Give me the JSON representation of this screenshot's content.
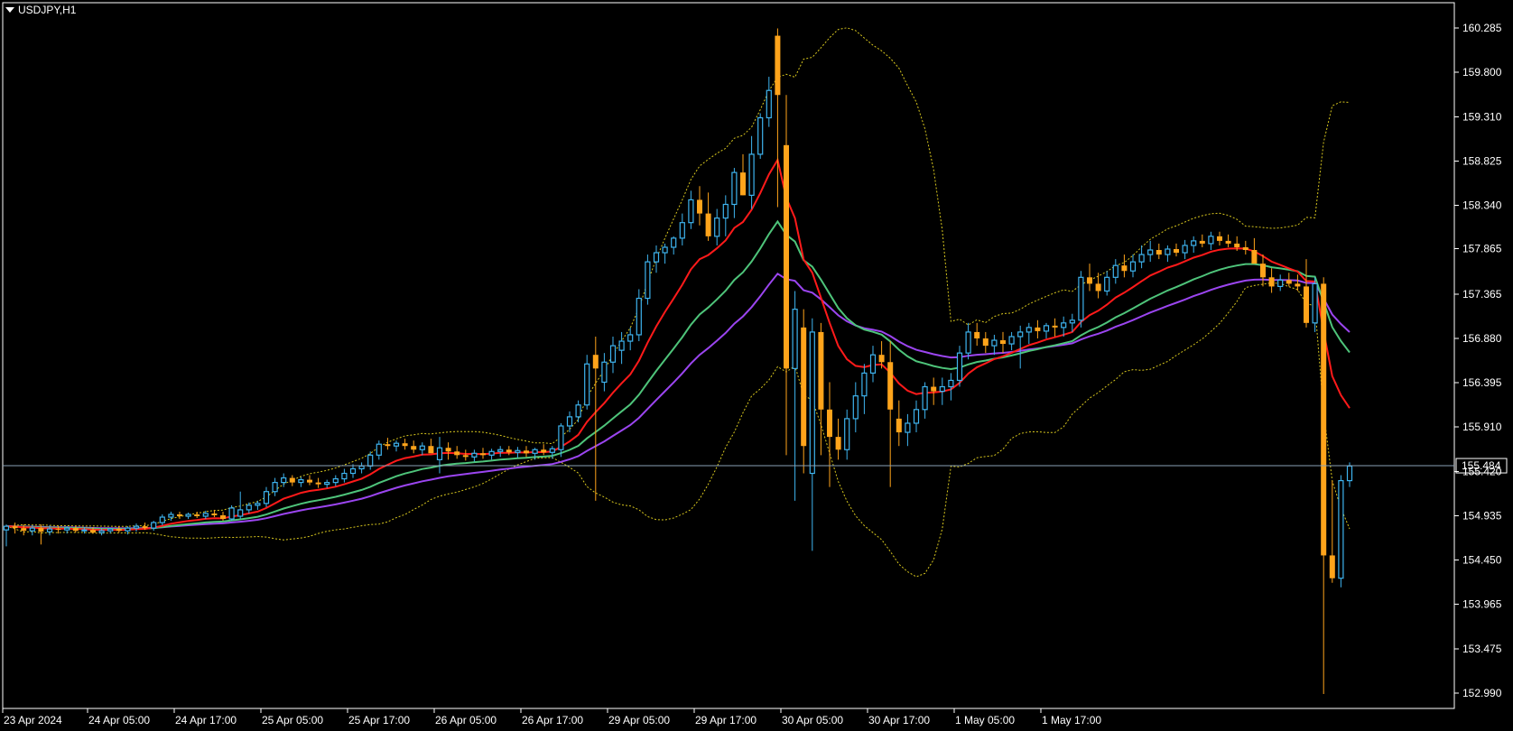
{
  "window": {
    "symbol_label": "USDJPY,H1"
  },
  "colors": {
    "background": "#000000",
    "frame": "#ffffff",
    "bull": "#3eb4ef",
    "bear": "#ffa41b",
    "ma_fast": "#ff1a1a",
    "ma_mid": "#4ec47a",
    "ma_slow": "#9b45f0",
    "envelope": "#d8c71e",
    "price_line": "#8aa0b4"
  },
  "chart_data": {
    "type": "candlestick",
    "symbol": "USDJPY",
    "timeframe": "H1",
    "price_axis": {
      "ticks": [
        "160.285",
        "159.800",
        "159.310",
        "158.825",
        "158.340",
        "157.865",
        "157.365",
        "156.880",
        "156.395",
        "155.910",
        "155.420",
        "154.935",
        "154.450",
        "153.965",
        "153.475",
        "152.990"
      ],
      "min": 152.99,
      "max": 160.285
    },
    "time_axis": {
      "labels": [
        "23 Apr 2024",
        "24 Apr 05:00",
        "24 Apr 17:00",
        "25 Apr 05:00",
        "25 Apr 17:00",
        "26 Apr 05:00",
        "26 Apr 17:00",
        "29 Apr 05:00",
        "29 Apr 17:00",
        "30 Apr 05:00",
        "30 Apr 17:00",
        "1 May 05:00",
        "1 May 17:00"
      ]
    },
    "current_price": "155.484",
    "candles": [
      [
        154.78,
        154.84,
        154.6,
        154.82
      ],
      [
        154.82,
        154.86,
        154.74,
        154.8
      ],
      [
        154.8,
        154.84,
        154.72,
        154.77
      ],
      [
        154.77,
        154.83,
        154.72,
        154.8
      ],
      [
        154.8,
        154.84,
        154.62,
        154.76
      ],
      [
        154.76,
        154.83,
        154.72,
        154.79
      ],
      [
        154.79,
        154.82,
        154.74,
        154.78
      ],
      [
        154.78,
        154.82,
        154.74,
        154.8
      ],
      [
        154.8,
        154.82,
        154.75,
        154.77
      ],
      [
        154.77,
        154.81,
        154.74,
        154.78
      ],
      [
        154.78,
        154.81,
        154.74,
        154.75
      ],
      [
        154.75,
        154.8,
        154.72,
        154.77
      ],
      [
        154.77,
        154.8,
        154.74,
        154.79
      ],
      [
        154.79,
        154.82,
        154.75,
        154.77
      ],
      [
        154.77,
        154.82,
        154.73,
        154.8
      ],
      [
        154.8,
        154.85,
        154.76,
        154.82
      ],
      [
        154.82,
        154.86,
        154.78,
        154.8
      ],
      [
        154.8,
        154.88,
        154.77,
        154.86
      ],
      [
        154.86,
        154.95,
        154.83,
        154.92
      ],
      [
        154.92,
        154.98,
        154.88,
        154.95
      ],
      [
        154.95,
        154.98,
        154.9,
        154.93
      ],
      [
        154.93,
        154.97,
        154.9,
        154.95
      ],
      [
        154.95,
        154.98,
        154.91,
        154.93
      ],
      [
        154.93,
        154.99,
        154.9,
        154.96
      ],
      [
        154.96,
        155.0,
        154.92,
        154.94
      ],
      [
        154.94,
        154.98,
        154.88,
        154.9
      ],
      [
        154.9,
        155.05,
        154.88,
        155.02
      ],
      [
        154.93,
        155.2,
        154.9,
        155.0
      ],
      [
        155.0,
        155.08,
        154.96,
        155.05
      ],
      [
        155.05,
        155.1,
        155.0,
        155.07
      ],
      [
        155.07,
        155.25,
        155.03,
        155.2
      ],
      [
        155.2,
        155.35,
        155.15,
        155.3
      ],
      [
        155.3,
        155.4,
        155.25,
        155.35
      ],
      [
        155.35,
        155.38,
        155.26,
        155.3
      ],
      [
        155.3,
        155.36,
        155.25,
        155.33
      ],
      [
        155.33,
        155.38,
        155.27,
        155.3
      ],
      [
        155.3,
        155.35,
        155.24,
        155.28
      ],
      [
        155.28,
        155.33,
        155.24,
        155.3
      ],
      [
        155.3,
        155.38,
        155.26,
        155.34
      ],
      [
        155.34,
        155.45,
        155.3,
        155.4
      ],
      [
        155.4,
        155.5,
        155.35,
        155.45
      ],
      [
        155.45,
        155.52,
        155.4,
        155.48
      ],
      [
        155.48,
        155.64,
        155.44,
        155.6
      ],
      [
        155.6,
        155.76,
        155.55,
        155.72
      ],
      [
        155.72,
        155.79,
        155.66,
        155.7
      ],
      [
        155.7,
        155.76,
        155.64,
        155.73
      ],
      [
        155.73,
        155.78,
        155.66,
        155.7
      ],
      [
        155.7,
        155.76,
        155.62,
        155.66
      ],
      [
        155.66,
        155.74,
        155.6,
        155.7
      ],
      [
        155.7,
        155.78,
        155.65,
        155.62
      ],
      [
        155.55,
        155.8,
        155.4,
        155.68
      ],
      [
        155.68,
        155.74,
        155.55,
        155.64
      ],
      [
        155.64,
        155.7,
        155.56,
        155.6
      ],
      [
        155.6,
        155.66,
        155.54,
        155.58
      ],
      [
        155.58,
        155.66,
        155.53,
        155.62
      ],
      [
        155.62,
        155.68,
        155.56,
        155.6
      ],
      [
        155.6,
        155.67,
        155.55,
        155.64
      ],
      [
        155.64,
        155.7,
        155.58,
        155.66
      ],
      [
        155.66,
        155.7,
        155.6,
        155.63
      ],
      [
        155.63,
        155.69,
        155.57,
        155.65
      ],
      [
        155.65,
        155.7,
        155.58,
        155.62
      ],
      [
        155.62,
        155.68,
        155.55,
        155.66
      ],
      [
        155.66,
        155.72,
        155.6,
        155.63
      ],
      [
        155.63,
        155.7,
        155.56,
        155.67
      ],
      [
        155.66,
        155.95,
        155.58,
        155.92
      ],
      [
        155.92,
        156.08,
        155.85,
        156.02
      ],
      [
        156.02,
        156.2,
        155.96,
        156.15
      ],
      [
        156.15,
        156.7,
        156.1,
        156.6
      ],
      [
        156.7,
        156.9,
        155.1,
        156.55
      ],
      [
        156.4,
        156.72,
        156.3,
        156.62
      ],
      [
        156.62,
        156.9,
        156.5,
        156.8
      ],
      [
        156.75,
        156.95,
        156.6,
        156.85
      ],
      [
        156.85,
        157.0,
        156.75,
        156.92
      ],
      [
        156.92,
        157.42,
        156.85,
        157.32
      ],
      [
        157.32,
        157.8,
        157.25,
        157.72
      ],
      [
        157.72,
        157.9,
        157.6,
        157.82
      ],
      [
        157.82,
        157.92,
        157.7,
        157.88
      ],
      [
        157.88,
        158.0,
        157.8,
        157.98
      ],
      [
        157.98,
        158.25,
        157.9,
        158.15
      ],
      [
        158.15,
        158.5,
        158.08,
        158.4
      ],
      [
        158.4,
        158.55,
        158.12,
        158.25
      ],
      [
        158.25,
        158.48,
        157.95,
        158.0
      ],
      [
        158.0,
        158.3,
        157.9,
        158.2
      ],
      [
        158.2,
        158.45,
        158.0,
        158.35
      ],
      [
        158.35,
        158.75,
        158.2,
        158.7
      ],
      [
        158.7,
        158.9,
        158.45,
        158.45
      ],
      [
        158.45,
        159.1,
        158.3,
        158.9
      ],
      [
        158.9,
        159.35,
        158.85,
        159.3
      ],
      [
        159.3,
        159.75,
        159.2,
        159.6
      ],
      [
        160.2,
        160.28,
        158.32,
        159.55
      ],
      [
        159.0,
        159.55,
        155.6,
        156.55
      ],
      [
        156.55,
        157.4,
        155.1,
        157.2
      ],
      [
        157.0,
        157.2,
        155.4,
        155.7
      ],
      [
        155.4,
        157.1,
        154.55,
        156.95
      ],
      [
        156.95,
        157.05,
        155.6,
        156.1
      ],
      [
        156.1,
        156.4,
        155.25,
        155.8
      ],
      [
        155.8,
        156.0,
        155.55,
        155.66
      ],
      [
        155.66,
        156.1,
        155.55,
        156.0
      ],
      [
        156.0,
        156.4,
        155.85,
        156.25
      ],
      [
        156.25,
        156.6,
        156.05,
        156.5
      ],
      [
        156.5,
        156.8,
        156.4,
        156.7
      ],
      [
        156.7,
        156.85,
        156.55,
        156.62
      ],
      [
        156.62,
        156.85,
        155.25,
        156.1
      ],
      [
        156.0,
        156.2,
        155.7,
        155.85
      ],
      [
        155.85,
        156.05,
        155.7,
        155.95
      ],
      [
        155.95,
        156.2,
        155.85,
        156.1
      ],
      [
        156.1,
        156.4,
        156.0,
        156.35
      ],
      [
        156.35,
        156.45,
        156.15,
        156.3
      ],
      [
        156.3,
        156.45,
        156.15,
        156.35
      ],
      [
        156.35,
        156.5,
        156.2,
        156.42
      ],
      [
        156.42,
        156.8,
        156.35,
        156.72
      ],
      [
        156.72,
        157.05,
        156.65,
        156.95
      ],
      [
        156.95,
        157.05,
        156.8,
        156.88
      ],
      [
        156.88,
        156.95,
        156.72,
        156.8
      ],
      [
        156.8,
        156.92,
        156.7,
        156.86
      ],
      [
        156.86,
        156.95,
        156.72,
        156.82
      ],
      [
        156.82,
        156.95,
        156.75,
        156.9
      ],
      [
        156.9,
        157.02,
        156.55,
        156.95
      ],
      [
        156.95,
        157.05,
        156.82,
        157.0
      ],
      [
        157.0,
        157.08,
        156.88,
        156.96
      ],
      [
        156.96,
        157.05,
        156.88,
        157.02
      ],
      [
        157.02,
        157.1,
        156.9,
        157.0
      ],
      [
        157.0,
        157.12,
        156.9,
        157.05
      ],
      [
        157.05,
        157.15,
        156.95,
        157.08
      ],
      [
        157.08,
        157.62,
        157.0,
        157.55
      ],
      [
        157.55,
        157.7,
        157.4,
        157.48
      ],
      [
        157.48,
        157.6,
        157.32,
        157.4
      ],
      [
        157.4,
        157.62,
        157.35,
        157.55
      ],
      [
        157.55,
        157.75,
        157.48,
        157.68
      ],
      [
        157.68,
        157.8,
        157.55,
        157.62
      ],
      [
        157.62,
        157.8,
        157.55,
        157.72
      ],
      [
        157.72,
        157.9,
        157.65,
        157.8
      ],
      [
        157.8,
        157.95,
        157.72,
        157.85
      ],
      [
        157.85,
        157.92,
        157.75,
        157.8
      ],
      [
        157.8,
        157.9,
        157.72,
        157.86
      ],
      [
        157.86,
        157.92,
        157.78,
        157.82
      ],
      [
        157.82,
        157.96,
        157.75,
        157.9
      ],
      [
        157.9,
        158.0,
        157.82,
        157.95
      ],
      [
        157.95,
        158.02,
        157.88,
        157.92
      ],
      [
        157.92,
        158.05,
        157.85,
        158.0
      ],
      [
        158.0,
        158.05,
        157.9,
        157.95
      ],
      [
        157.95,
        158.02,
        157.88,
        157.92
      ],
      [
        157.92,
        158.0,
        157.84,
        157.88
      ],
      [
        157.88,
        157.95,
        157.8,
        157.85
      ],
      [
        157.85,
        157.98,
        157.78,
        157.7
      ],
      [
        157.7,
        157.8,
        157.45,
        157.55
      ],
      [
        157.55,
        157.65,
        157.38,
        157.45
      ],
      [
        157.45,
        157.58,
        157.4,
        157.52
      ],
      [
        157.52,
        157.6,
        157.45,
        157.48
      ],
      [
        157.48,
        157.58,
        157.4,
        157.45
      ],
      [
        157.45,
        157.75,
        157.0,
        157.05
      ],
      [
        157.05,
        157.55,
        156.95,
        157.48
      ],
      [
        157.48,
        157.55,
        152.98,
        154.5
      ],
      [
        154.5,
        155.32,
        154.2,
        154.25
      ],
      [
        154.25,
        155.38,
        154.15,
        155.32
      ],
      [
        155.32,
        155.52,
        155.25,
        155.48
      ]
    ]
  }
}
